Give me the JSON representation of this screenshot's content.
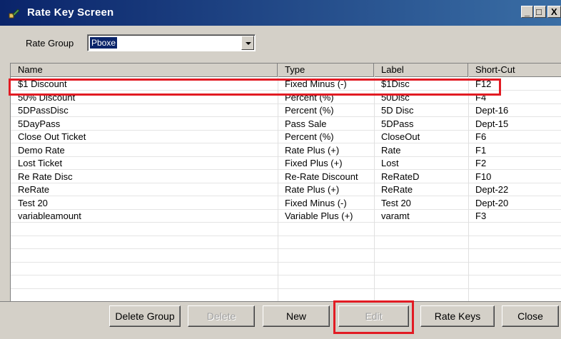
{
  "window": {
    "title": "Rate Key Screen",
    "controls": {
      "minimize": "_",
      "maximize": "□",
      "close": "X"
    }
  },
  "filter": {
    "label": "Rate Group",
    "value": "Pboxe"
  },
  "grid": {
    "columns": [
      "Name",
      "Type",
      "Label",
      "Short-Cut"
    ],
    "rows": [
      {
        "name": "$1 Discount",
        "type": "Fixed Minus (-)",
        "label": "$1Disc",
        "shortcut": "F12"
      },
      {
        "name": "50% Discount",
        "type": "Percent (%)",
        "label": "50Disc",
        "shortcut": "F4"
      },
      {
        "name": "5DPassDisc",
        "type": "Percent (%)",
        "label": "5D Disc",
        "shortcut": "Dept-16"
      },
      {
        "name": "5DayPass",
        "type": "Pass Sale",
        "label": "5DPass",
        "shortcut": "Dept-15"
      },
      {
        "name": "Close Out Ticket",
        "type": "Percent (%)",
        "label": "CloseOut",
        "shortcut": "F6"
      },
      {
        "name": "Demo Rate",
        "type": "Rate Plus (+)",
        "label": "Rate",
        "shortcut": "F1"
      },
      {
        "name": "Lost Ticket",
        "type": "Fixed Plus (+)",
        "label": "Lost",
        "shortcut": "F2"
      },
      {
        "name": "Re Rate Disc",
        "type": "Re-Rate Discount",
        "label": "ReRateD",
        "shortcut": "F10"
      },
      {
        "name": "ReRate",
        "type": "Rate Plus (+)",
        "label": "ReRate",
        "shortcut": "Dept-22"
      },
      {
        "name": "Test 20",
        "type": "Fixed Minus (-)",
        "label": "Test 20",
        "shortcut": "Dept-20"
      },
      {
        "name": "variableamount",
        "type": "Variable Plus (+)",
        "label": "varamt",
        "shortcut": "F3"
      }
    ]
  },
  "buttons": {
    "delete_group": "Delete Group",
    "delete": "Delete",
    "new": "New",
    "edit": "Edit",
    "rate_keys": "Rate Keys",
    "close": "Close"
  },
  "colors": {
    "highlight": "#e21b23",
    "titlebar": "#0a246a"
  }
}
